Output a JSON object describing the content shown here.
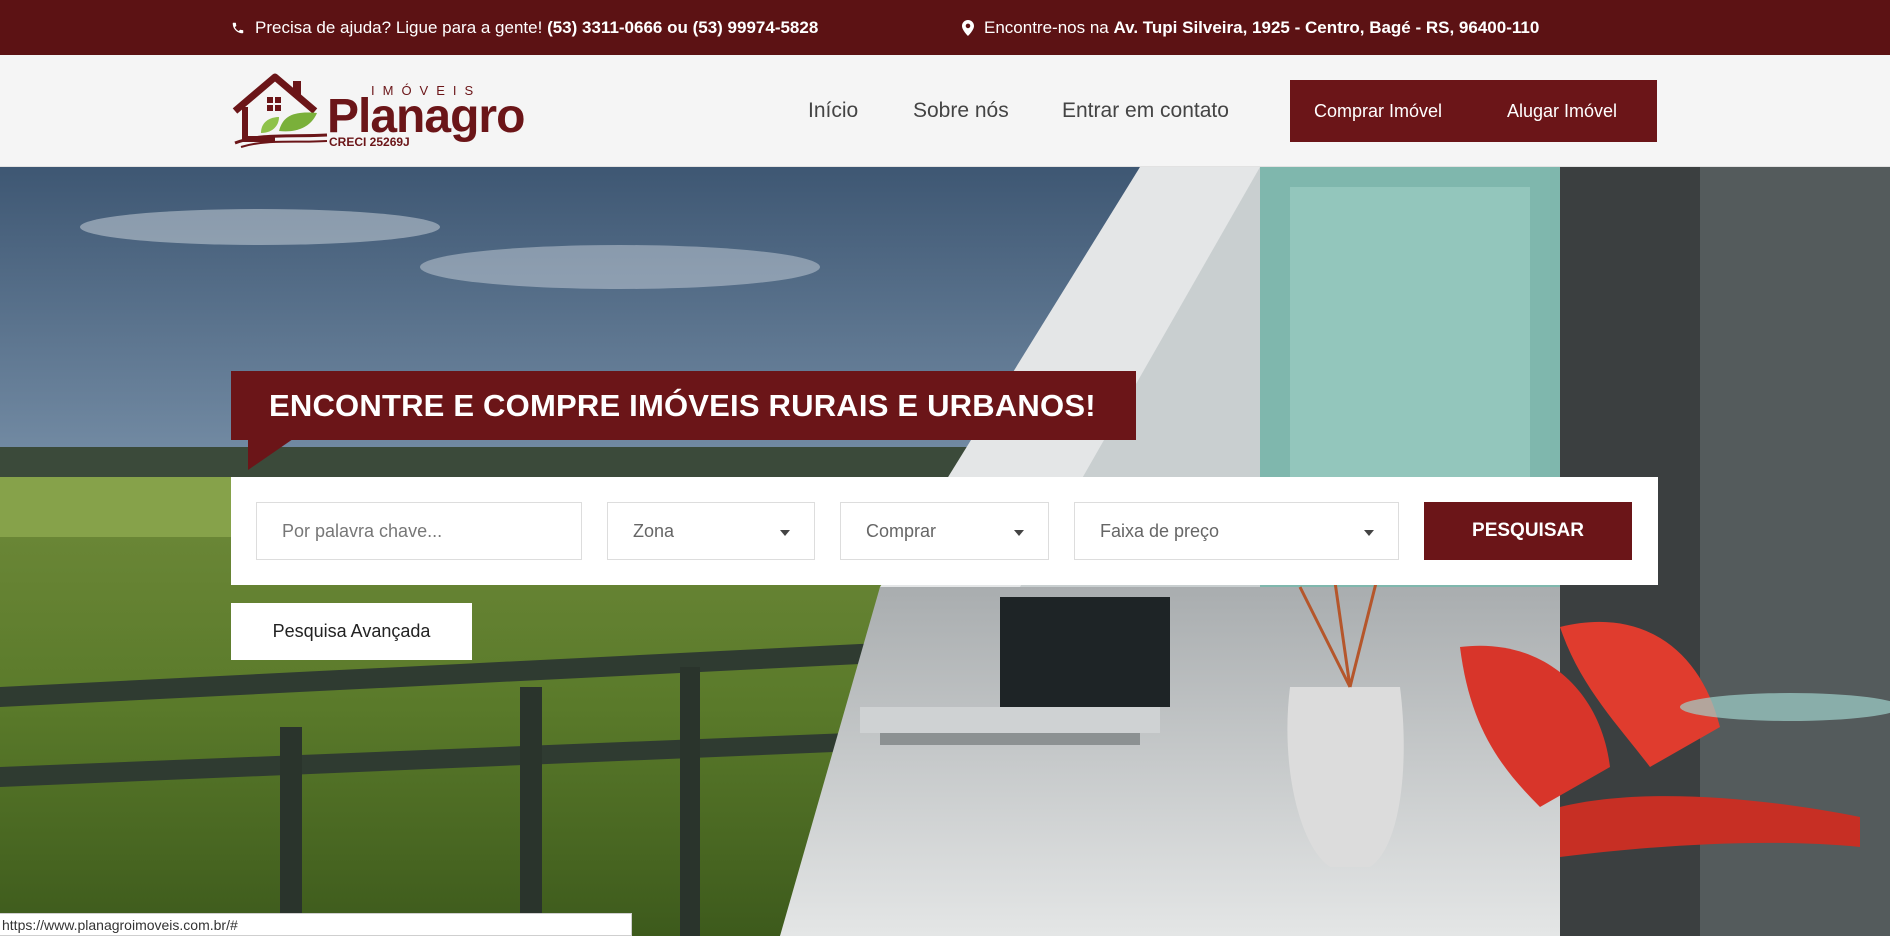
{
  "topbar": {
    "help_text": "Precisa de ajuda? Ligue para a gente!",
    "phones": "(53) 3311-0666 ou (53) 99974-5828",
    "find_text": "Encontre-nos na",
    "address": "Av. Tupi Silveira, 1925 - Centro, Bagé - RS, 96400-110"
  },
  "logo": {
    "name": "Planagro",
    "sub": "IMÓVEIS",
    "creci": "CRECI 25269J"
  },
  "nav": {
    "inicio": "Início",
    "sobre": "Sobre nós",
    "contato": "Entrar em contato",
    "comprar": "Comprar Imóvel",
    "alugar": "Alugar Imóvel"
  },
  "hero": {
    "headline": "ENCONTRE E COMPRE IMÓVEIS RURAIS E URBANOS!"
  },
  "search": {
    "keyword_placeholder": "Por palavra chave...",
    "zona": "Zona",
    "tipo": "Comprar",
    "faixa": "Faixa de preço",
    "button": "PESQUISAR",
    "advanced": "Pesquisa Avançada"
  },
  "status_url": "https://www.planagroimoveis.com.br/#",
  "colors": {
    "brand": "#6b1518",
    "topbar": "#5c1214"
  }
}
